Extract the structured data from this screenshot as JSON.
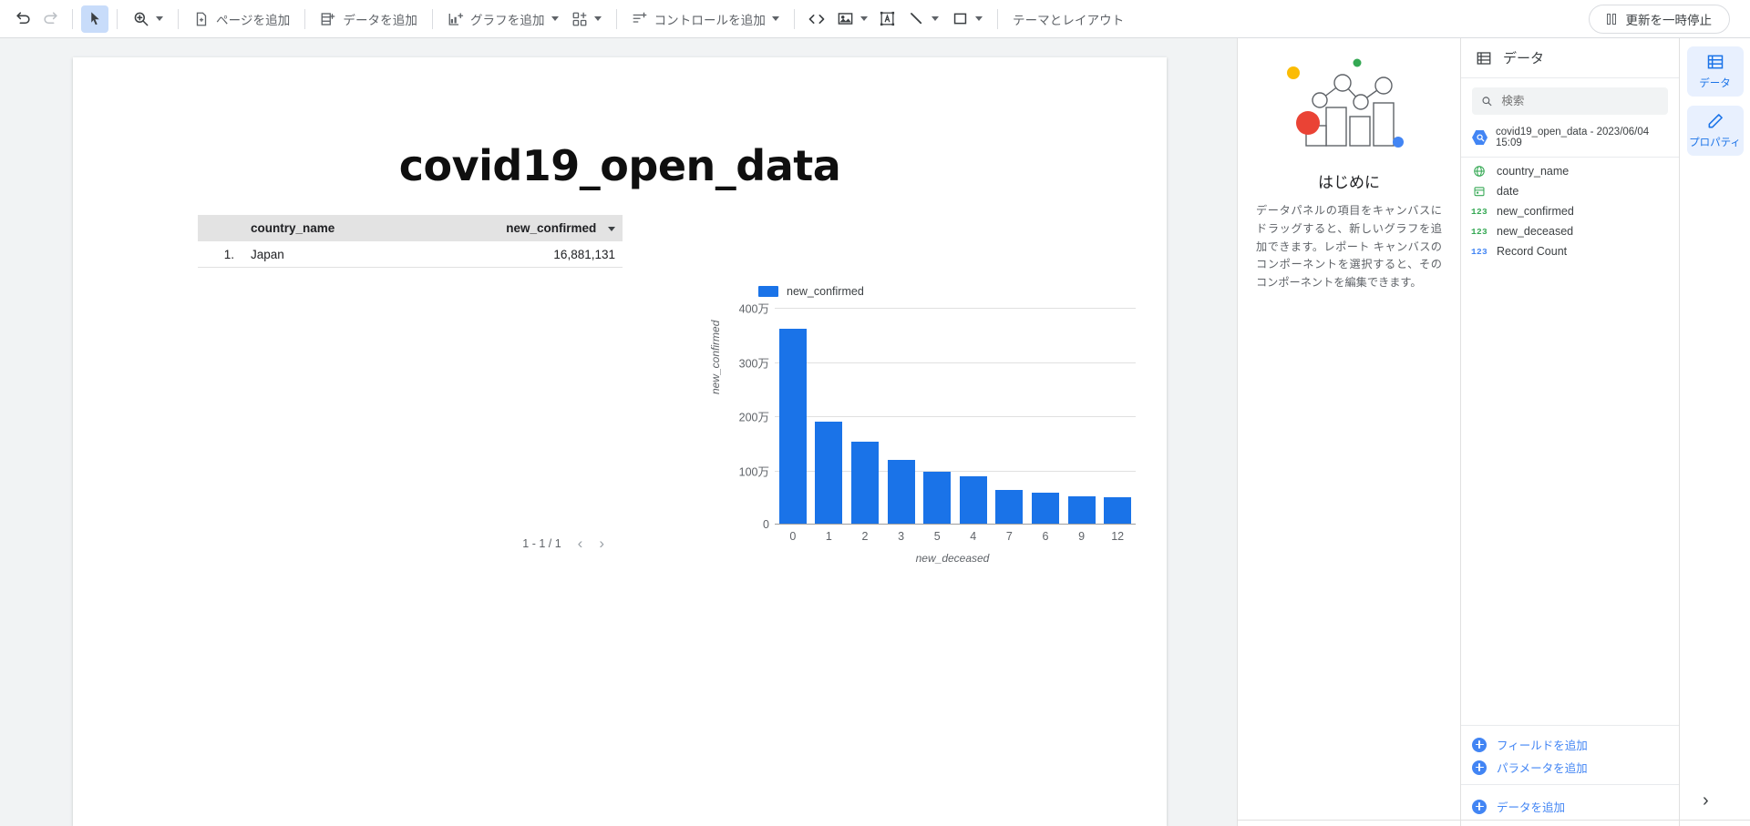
{
  "toolbar": {
    "undo": "undo-icon",
    "redo": "redo-icon",
    "select": "cursor-icon",
    "zoom": "magnifier-icon",
    "add_page": "ページを追加",
    "add_data": "データを追加",
    "add_chart": "グラフを追加",
    "add_community": "community-viz-icon",
    "add_control": "コントロールを追加",
    "embed": "embed-code-icon",
    "image": "image-icon",
    "text": "text-box-icon",
    "line": "line-icon",
    "shape": "rectangle-icon",
    "theme_layout": "テーマとレイアウト",
    "pause_updates": "更新を一時停止"
  },
  "canvas": {
    "title": "covid19_open_data"
  },
  "table": {
    "headers": [
      "country_name",
      "new_confirmed"
    ],
    "rows": [
      {
        "index": "1.",
        "country_name": "Japan",
        "new_confirmed": "16,881,131"
      }
    ],
    "pager": "1 - 1 / 1",
    "prev": "‹",
    "next": "›"
  },
  "chart_data": {
    "type": "bar",
    "title": "",
    "legend": [
      "new_confirmed"
    ],
    "legend_position": "top-left",
    "xlabel": "new_deceased",
    "ylabel": "new_confirmed",
    "categories": [
      "0",
      "1",
      "2",
      "3",
      "5",
      "4",
      "7",
      "6",
      "9",
      "12"
    ],
    "values": [
      3600000,
      1890000,
      1520000,
      1170000,
      960000,
      870000,
      620000,
      580000,
      510000,
      490000
    ],
    "ylim": [
      0,
      4000000
    ],
    "yticks": [
      0,
      1000000,
      2000000,
      3000000,
      4000000
    ],
    "ytick_labels": [
      "0",
      "100万",
      "200万",
      "300万",
      "400万"
    ],
    "grid": true,
    "series_color": "#1a73e8"
  },
  "intro": {
    "title": "はじめに",
    "body": "データパネルの項目をキャンバスにドラッグすると、新しいグラフを追加できます。レポート キャンバスのコンポーネントを選択すると、そのコンポーネントを編集できます。"
  },
  "data_panel": {
    "header": "データ",
    "search_placeholder": "検索",
    "search_value": "",
    "source": "covid19_open_data - 2023/06/04 15:09",
    "fields": [
      {
        "name": "country_name",
        "type": "geo",
        "icon": "globe-icon",
        "color": "#34a853"
      },
      {
        "name": "date",
        "type": "date",
        "icon": "calendar-icon",
        "color": "#34a853"
      },
      {
        "name": "new_confirmed",
        "type": "number",
        "icon": "123",
        "color": "#34a853"
      },
      {
        "name": "new_deceased",
        "type": "number",
        "icon": "123",
        "color": "#34a853"
      },
      {
        "name": "Record Count",
        "type": "number",
        "icon": "123",
        "color": "#4285f4"
      }
    ],
    "actions": [
      {
        "label": "フィールドを追加"
      },
      {
        "label": "パラメータを追加"
      }
    ],
    "add_data": "データを追加"
  },
  "rail": {
    "tabs": [
      {
        "label": "データ",
        "icon": "data-table-icon",
        "active": true
      },
      {
        "label": "プロパティ",
        "icon": "pencil-icon",
        "active": true
      }
    ],
    "expand": "›"
  },
  "colors": {
    "accent": "#1a73e8",
    "toolbar_text": "#5f6368",
    "canvas_bg": "#f1f3f4"
  }
}
